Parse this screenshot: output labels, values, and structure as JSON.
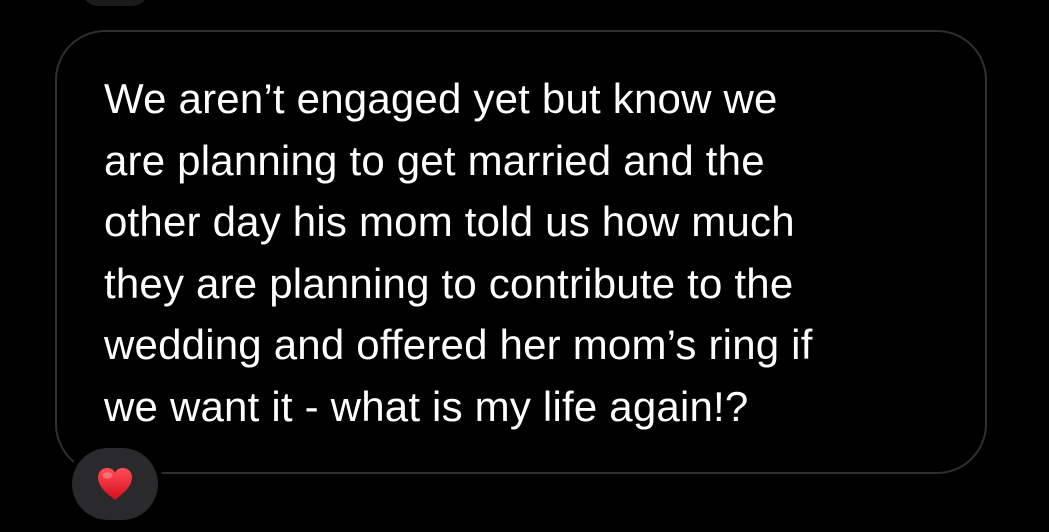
{
  "message": {
    "lines": [
      "We aren’t engaged yet but know we",
      "are planning to get married and the",
      "other day his mom told us how much",
      "they are planning to contribute to the",
      "wedding and offered her mom’s ring if",
      "we want it - what is my life again!?"
    ]
  },
  "reaction": {
    "icon": "heart-icon",
    "heart_color": "#e8202d"
  },
  "colors": {
    "background": "#000000",
    "bubble_border": "#2f2f31",
    "reaction_background": "#2a2a2c",
    "text": "#ffffff"
  }
}
